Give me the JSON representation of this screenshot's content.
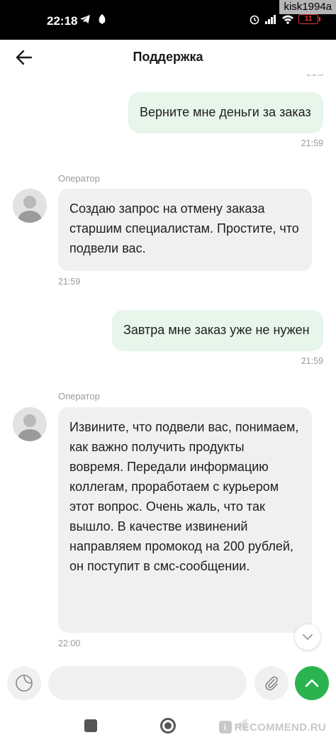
{
  "status_bar": {
    "time": "22:18",
    "battery": "11",
    "battery_color": "#e53935"
  },
  "watermark_top": "kisk1994a",
  "header": {
    "title": "Поддержка",
    "back_icon": "arrow-left-icon"
  },
  "messages": [
    {
      "direction": "outgoing",
      "text": "Верните мне деньги за заказ",
      "time": "21:59"
    },
    {
      "direction": "incoming",
      "sender": "Оператор",
      "text": "Создаю запрос на отмену заказа старшим специалистам. Простите, что подвели вас.",
      "time": "21:59"
    },
    {
      "direction": "outgoing",
      "text": "Завтра мне заказ уже не нужен",
      "time": "21:59"
    },
    {
      "direction": "incoming",
      "sender": "Оператор",
      "text": "Извините, что подвели вас, понимаем, как важно получить продукты вовремя. Передали информацию коллегам, проработаем с курьером этот вопрос. Очень жаль, что так вышло. В качестве извинений направляем промокод на 200 рублей, он поступит в смс-сообщении.",
      "time": "22:00"
    }
  ],
  "composer": {
    "placeholder": "",
    "sticker_icon": "sticker-icon",
    "attach_icon": "paperclip-icon",
    "send_icon": "chevron-up-icon"
  },
  "watermark_bottom": "RECOMMEND.RU",
  "colors": {
    "outgoing_bubble": "#e7f5ea",
    "incoming_bubble": "#f0f0f0",
    "accent": "#2bb34f"
  }
}
